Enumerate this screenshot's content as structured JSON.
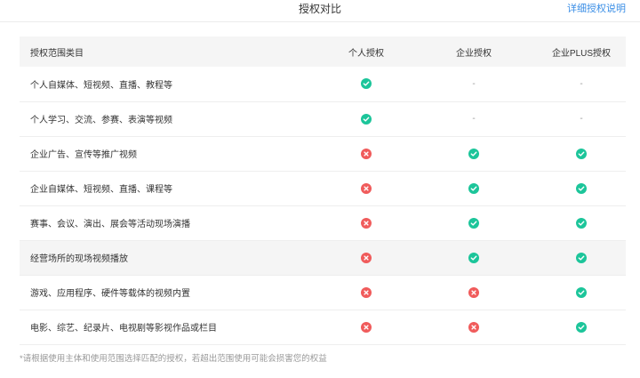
{
  "header": {
    "title": "授权对比",
    "detail_link": "详细授权说明"
  },
  "table": {
    "columns": [
      "授权范围类目",
      "个人授权",
      "企业授权",
      "企业PLUS授权"
    ],
    "rows": [
      {
        "label": "个人自媒体、短视频、直播、教程等",
        "cells": [
          "check",
          "dash",
          "dash"
        ]
      },
      {
        "label": "个人学习、交流、参赛、表演等视频",
        "cells": [
          "check",
          "dash",
          "dash"
        ]
      },
      {
        "label": "企业广告、宣传等推广视频",
        "cells": [
          "cross",
          "check",
          "check"
        ]
      },
      {
        "label": "企业自媒体、短视频、直播、课程等",
        "cells": [
          "cross",
          "check",
          "check"
        ]
      },
      {
        "label": "赛事、会议、演出、展会等活动现场演播",
        "cells": [
          "cross",
          "check",
          "check"
        ]
      },
      {
        "label": "经营场所的现场视频播放",
        "cells": [
          "cross",
          "check",
          "check"
        ]
      },
      {
        "label": "游戏、应用程序、硬件等载体的视频内置",
        "cells": [
          "cross",
          "cross",
          "check"
        ]
      },
      {
        "label": "电影、综艺、纪录片、电视剧等影视作品或栏目",
        "cells": [
          "cross",
          "cross",
          "check"
        ]
      }
    ],
    "dash_text": "-",
    "highlighted_row": 5
  },
  "icons": {
    "check": "check-circle-icon",
    "cross": "cross-circle-icon",
    "dash": "dash"
  },
  "colors": {
    "check": "#1cc59a",
    "cross": "#f05b5b",
    "link": "#3a8ee6"
  },
  "footnote": "*请根据使用主体和使用范围选择匹配的授权，若超出范围使用可能会损害您的权益"
}
